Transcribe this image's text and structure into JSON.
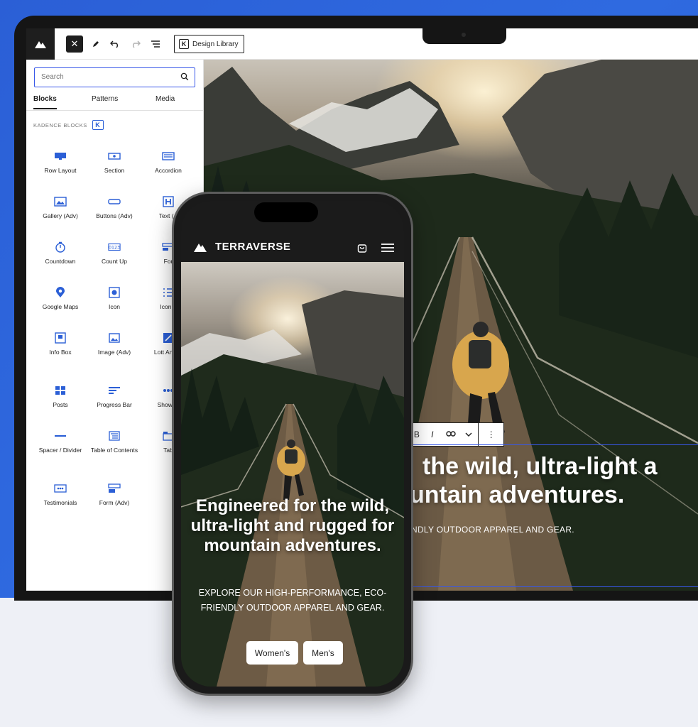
{
  "toolbar": {
    "design_library_label": "Design Library"
  },
  "sidebar": {
    "search_placeholder": "Search",
    "tabs": [
      "Blocks",
      "Patterns",
      "Media"
    ],
    "section_title": "KADENCE BLOCKS",
    "blocks": [
      [
        "Row Layout",
        "Section",
        "Accordion"
      ],
      [
        "Gallery (Adv)",
        "Buttons (Adv)",
        "Text (A"
      ],
      [
        "Countdown",
        "Count Up",
        "For"
      ],
      [
        "Google Maps",
        "Icon",
        "Icon L"
      ],
      [
        "Info Box",
        "Image (Adv)",
        "Lott Anima"
      ],
      [
        "Posts",
        "Progress Bar",
        "Show M"
      ],
      [
        "Spacer / Divider",
        "Table of Contents",
        "Tab"
      ],
      [
        "Testimonials",
        "Form (Adv)"
      ]
    ]
  },
  "canvas": {
    "headline_line1": "the wild, ultra-light a",
    "headline_line2": "untain adventures.",
    "subline": "NDLY OUTDOOR APPAREL AND GEAR."
  },
  "phone": {
    "brand": "TERRAVERSE",
    "headline": "Engineered for the wild, ultra-light and rugged for mountain adventures.",
    "subline": "EXPLORE OUR HIGH-PERFORMANCE, ECO-FRIENDLY OUTDOOR APPAREL AND GEAR.",
    "buttons": [
      "Women's",
      "Men's"
    ]
  },
  "colors": {
    "accent": "#3858e9",
    "backdrop": "#2b5fd6",
    "dark": "#1e1e1e"
  }
}
